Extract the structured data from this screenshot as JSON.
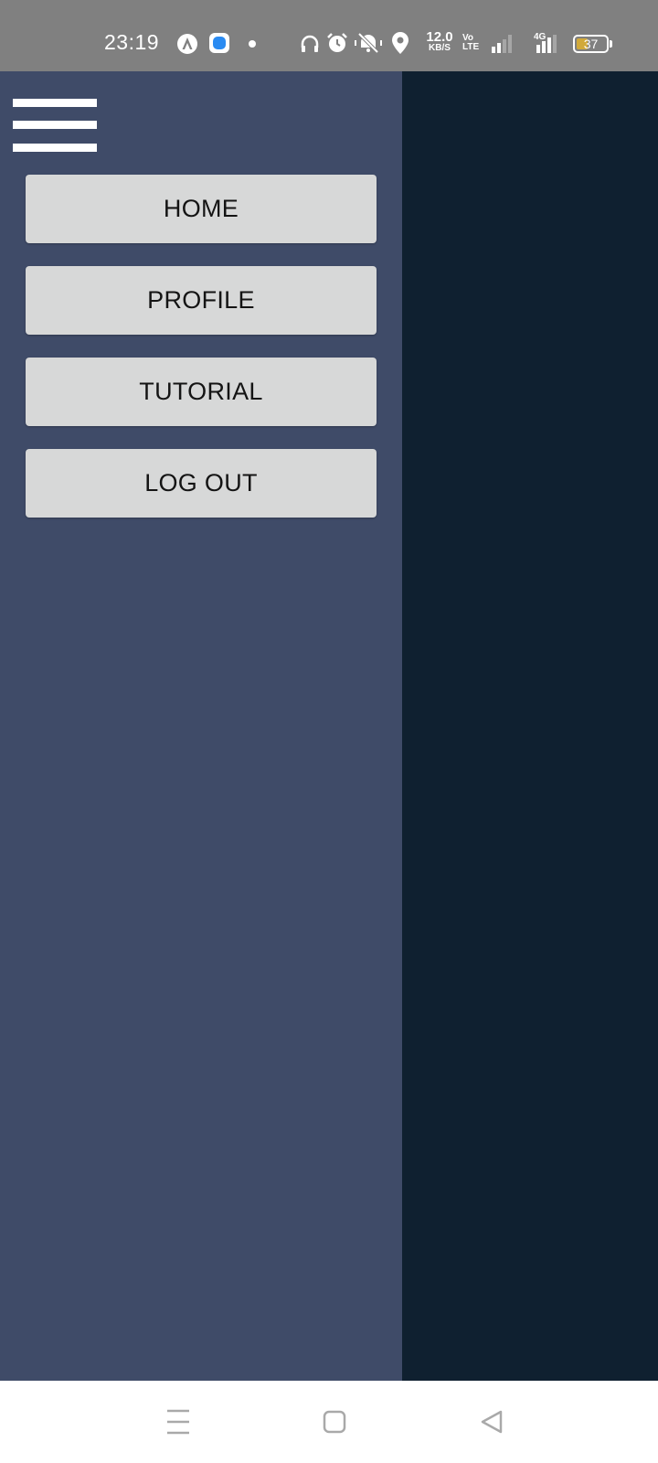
{
  "status_bar": {
    "time": "23:19",
    "net_speed_value": "12.0",
    "net_speed_unit": "KB/S",
    "volte_top": "Vo",
    "volte_bottom": "LTE",
    "network_type": "4G",
    "battery_level": "37",
    "battery_percent": 37,
    "battery_color": "#d1a93a",
    "icons": [
      "app-a-icon",
      "app-blue-icon",
      "notification-dot-icon",
      "headphones-icon",
      "alarm-icon",
      "vibrate-mute-icon",
      "location-icon",
      "signal-icon-1",
      "signal-icon-2",
      "battery-icon"
    ]
  },
  "drawer": {
    "background": "#3f4b68",
    "menu_icon": "hamburger-menu-icon",
    "items": [
      {
        "label": "HOME"
      },
      {
        "label": "PROFILE"
      },
      {
        "label": "TUTORIAL"
      },
      {
        "label": "LOG OUT"
      }
    ]
  },
  "scrim": {
    "background": "#0f2030"
  },
  "nav_bar": {
    "icons": [
      "recents-icon",
      "home-icon",
      "back-icon"
    ]
  }
}
